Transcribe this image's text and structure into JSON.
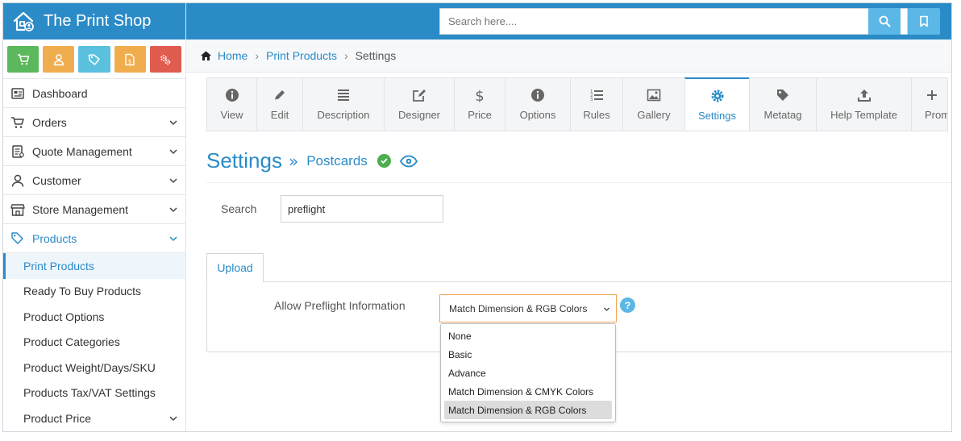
{
  "app": {
    "title": "The Print Shop"
  },
  "search": {
    "placeholder": "Search here...."
  },
  "quick_actions": [
    {
      "icon": "cart-icon",
      "color": "#5cb85c"
    },
    {
      "icon": "user-icon",
      "color": "#f0ad4e"
    },
    {
      "icon": "tag-icon",
      "color": "#5bc0de"
    },
    {
      "icon": "file-dollar-icon",
      "color": "#f0ad4e"
    },
    {
      "icon": "gears-icon",
      "color": "#e05c4e"
    }
  ],
  "sidebar": {
    "items": [
      {
        "label": "Dashboard"
      },
      {
        "label": "Orders"
      },
      {
        "label": "Quote Management"
      },
      {
        "label": "Customer"
      },
      {
        "label": "Store Management"
      },
      {
        "label": "Products"
      }
    ],
    "sub_items": [
      {
        "label": "Print Products"
      },
      {
        "label": "Ready To Buy Products"
      },
      {
        "label": "Product Options"
      },
      {
        "label": "Product Categories"
      },
      {
        "label": "Product Weight/Days/SKU"
      },
      {
        "label": "Products Tax/VAT Settings"
      },
      {
        "label": "Product Price"
      }
    ]
  },
  "breadcrumb": {
    "home": "Home",
    "products": "Print Products",
    "current": "Settings"
  },
  "tabs": [
    {
      "label": "View",
      "icon": "info-icon"
    },
    {
      "label": "Edit",
      "icon": "pencil-icon"
    },
    {
      "label": "Description",
      "icon": "list-icon"
    },
    {
      "label": "Designer",
      "icon": "edit-square-icon"
    },
    {
      "label": "Price",
      "icon": "dollar-icon"
    },
    {
      "label": "Options",
      "icon": "info-icon"
    },
    {
      "label": "Rules",
      "icon": "ordered-list-icon"
    },
    {
      "label": "Gallery",
      "icon": "image-icon"
    },
    {
      "label": "Settings",
      "icon": "gear-icon"
    },
    {
      "label": "Metatag",
      "icon": "tag-icon"
    },
    {
      "label": "Help Template",
      "icon": "upload-icon"
    },
    {
      "label": "Promo",
      "icon": "plus-icon"
    }
  ],
  "page": {
    "title": "Settings",
    "product_name": "Postcards"
  },
  "settings_search": {
    "label": "Search",
    "value": "preflight"
  },
  "upload": {
    "tab_label": "Upload",
    "field_label": "Allow Preflight Information",
    "selected": "Match Dimension & RGB Colors",
    "help": "?",
    "options": [
      "None",
      "Basic",
      "Advance",
      "Match Dimension & CMYK Colors",
      "Match Dimension & RGB Colors"
    ]
  },
  "colors": {
    "accent": "#2a8bc7",
    "topbar": "#2a8bc7",
    "select_border": "#f0a552"
  }
}
